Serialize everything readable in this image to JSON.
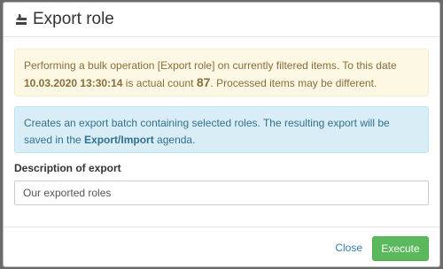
{
  "dialog": {
    "title": "Export role",
    "icon": "export-icon"
  },
  "warning": {
    "text_before": "Performing a bulk operation [Export role] on currently filtered items. To this date ",
    "date": "10.03.2020 13:30:14",
    "text_middle": " is actual count ",
    "count": "87",
    "text_after": ". Processed items may be different."
  },
  "info": {
    "text_before": "Creates an export batch containing selected roles. The resulting export will be saved in the ",
    "agenda": "Export/Import",
    "text_after": " agenda."
  },
  "form": {
    "label": "Description of export",
    "value": "Our exported roles"
  },
  "footer": {
    "close_label": "Close",
    "execute_label": "Execute"
  },
  "colors": {
    "warning_bg": "#fcf8e3",
    "info_bg": "#d9edf7",
    "success": "#5cb85c",
    "link": "#337ab7"
  }
}
